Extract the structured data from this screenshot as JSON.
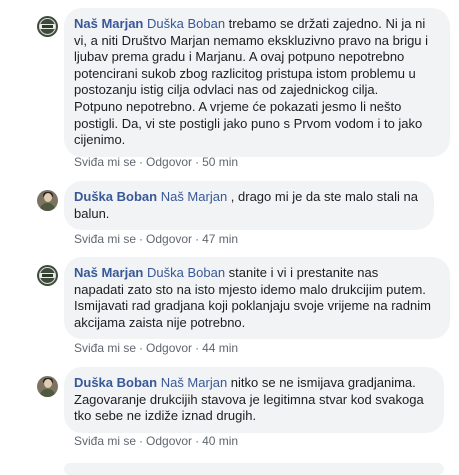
{
  "comments": [
    {
      "author": "Naš Marjan",
      "avatar": "page-logo",
      "mention": "Duška Boban",
      "text": " trebamo se držati zajedno. Ni ja ni\nvi, a niti Društvo Marjan nemamo ekskluzivno pravo na brigu i\nljubav prema gradu i Marjanu. A ovaj potpuno nepotrebno\npotencirani sukob zbog razlicitog pristupa istom problemu u\npostozanju istig cilja odvlaci nas od zajednickog cilja.\nPotpuno nepotrebno. A vrjeme će pokazati jesmo li nešto\npostigli. Da, vi ste postigli jako puno s Prvom vodom i to jako\ncijenimo.",
      "like": "Sviđa mi se",
      "reply": "Odgovor",
      "time": "50 min"
    },
    {
      "author": "Duška Boban",
      "avatar": "user-photo",
      "mention": "Naš Marjan",
      "text": " , drago mi je da ste malo stali na\nbalun.",
      "like": "Sviđa mi se",
      "reply": "Odgovor",
      "time": "47 min"
    },
    {
      "author": "Naš Marjan",
      "avatar": "page-logo",
      "mention": "Duška Boban",
      "text": " stanite i vi i prestanite nas\nnapadati zato sto na isto mjesto idemo malo drukcijim putem.\nIsmijavati rad gradjana koji poklanjaju svoje vrijeme na radnim\nakcijama zaista nije potrebno.",
      "like": "Sviđa mi se",
      "reply": "Odgovor",
      "time": "44 min"
    },
    {
      "author": "Duška Boban",
      "avatar": "user-photo",
      "mention": "Naš Marjan",
      "text": " nitko se ne ismijava gradjanima.\nZagovaranje drukcijih stavova je legitimna stvar kod svakoga\ntko sebe ne izdiže iznad drugih.",
      "like": "Sviđa mi se",
      "reply": "Odgovor",
      "time": "40 min"
    }
  ],
  "separator": "·"
}
